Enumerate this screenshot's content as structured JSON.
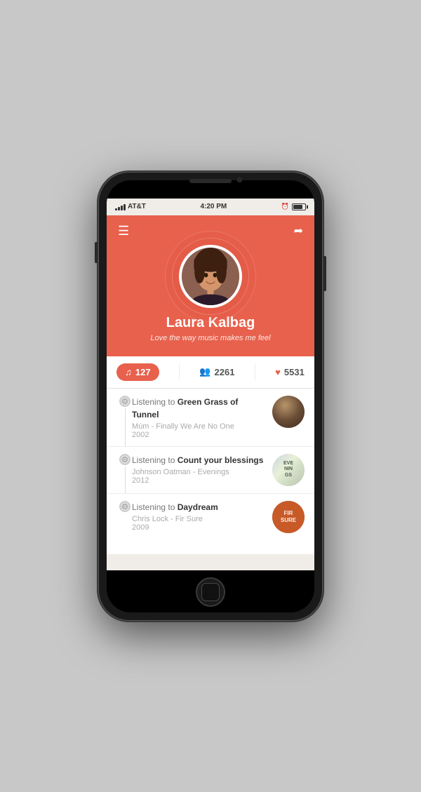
{
  "device": {
    "carrier": "AT&T",
    "time": "4:20 PM",
    "signal_bars": [
      3,
      5,
      7,
      9,
      11
    ]
  },
  "profile": {
    "name": "Laura Kalbag",
    "bio": "Love the way music makes me feel",
    "stats": {
      "tracks": {
        "count": "127",
        "icon": "♫"
      },
      "following": {
        "count": "2261",
        "icon": "👥"
      },
      "likes": {
        "count": "5531",
        "icon": "♥"
      }
    }
  },
  "nav": {
    "menu_label": "☰",
    "share_label": "➦"
  },
  "feed": {
    "items": [
      {
        "prefix": "Listening to ",
        "title": "Green Grass of Tunnel",
        "artist_line": "Múm - Finally We Are No One",
        "year": "2002"
      },
      {
        "prefix": "Listening to ",
        "title": "Count your blessings",
        "artist_line": "Johnson Oatman  - Evenings",
        "year": "2012"
      },
      {
        "prefix": "Listening to ",
        "title": "Daydream",
        "artist_line": "Chris Lock - Fir Sure",
        "year": "2009"
      }
    ],
    "thumb_labels": [
      "",
      "EVE\nNIN\nGS",
      "FIR\nSURE"
    ]
  }
}
